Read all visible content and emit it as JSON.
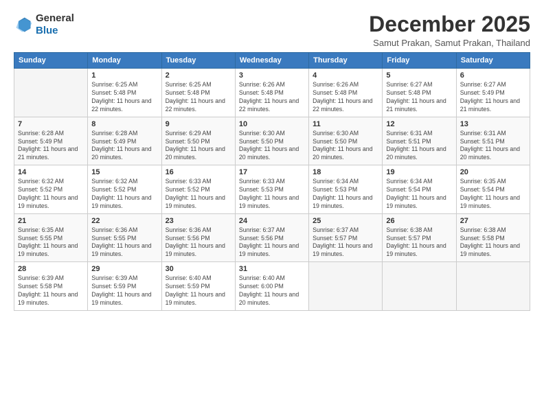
{
  "logo": {
    "line1": "General",
    "line2": "Blue"
  },
  "header": {
    "month": "December 2025",
    "location": "Samut Prakan, Samut Prakan, Thailand"
  },
  "weekdays": [
    "Sunday",
    "Monday",
    "Tuesday",
    "Wednesday",
    "Thursday",
    "Friday",
    "Saturday"
  ],
  "weeks": [
    [
      {
        "day": "",
        "info": ""
      },
      {
        "day": "1",
        "info": "Sunrise: 6:25 AM\nSunset: 5:48 PM\nDaylight: 11 hours and 22 minutes."
      },
      {
        "day": "2",
        "info": "Sunrise: 6:25 AM\nSunset: 5:48 PM\nDaylight: 11 hours and 22 minutes."
      },
      {
        "day": "3",
        "info": "Sunrise: 6:26 AM\nSunset: 5:48 PM\nDaylight: 11 hours and 22 minutes."
      },
      {
        "day": "4",
        "info": "Sunrise: 6:26 AM\nSunset: 5:48 PM\nDaylight: 11 hours and 22 minutes."
      },
      {
        "day": "5",
        "info": "Sunrise: 6:27 AM\nSunset: 5:48 PM\nDaylight: 11 hours and 21 minutes."
      },
      {
        "day": "6",
        "info": "Sunrise: 6:27 AM\nSunset: 5:49 PM\nDaylight: 11 hours and 21 minutes."
      }
    ],
    [
      {
        "day": "7",
        "info": "Sunrise: 6:28 AM\nSunset: 5:49 PM\nDaylight: 11 hours and 21 minutes."
      },
      {
        "day": "8",
        "info": "Sunrise: 6:28 AM\nSunset: 5:49 PM\nDaylight: 11 hours and 20 minutes."
      },
      {
        "day": "9",
        "info": "Sunrise: 6:29 AM\nSunset: 5:50 PM\nDaylight: 11 hours and 20 minutes."
      },
      {
        "day": "10",
        "info": "Sunrise: 6:30 AM\nSunset: 5:50 PM\nDaylight: 11 hours and 20 minutes."
      },
      {
        "day": "11",
        "info": "Sunrise: 6:30 AM\nSunset: 5:50 PM\nDaylight: 11 hours and 20 minutes."
      },
      {
        "day": "12",
        "info": "Sunrise: 6:31 AM\nSunset: 5:51 PM\nDaylight: 11 hours and 20 minutes."
      },
      {
        "day": "13",
        "info": "Sunrise: 6:31 AM\nSunset: 5:51 PM\nDaylight: 11 hours and 20 minutes."
      }
    ],
    [
      {
        "day": "14",
        "info": "Sunrise: 6:32 AM\nSunset: 5:52 PM\nDaylight: 11 hours and 19 minutes."
      },
      {
        "day": "15",
        "info": "Sunrise: 6:32 AM\nSunset: 5:52 PM\nDaylight: 11 hours and 19 minutes."
      },
      {
        "day": "16",
        "info": "Sunrise: 6:33 AM\nSunset: 5:52 PM\nDaylight: 11 hours and 19 minutes."
      },
      {
        "day": "17",
        "info": "Sunrise: 6:33 AM\nSunset: 5:53 PM\nDaylight: 11 hours and 19 minutes."
      },
      {
        "day": "18",
        "info": "Sunrise: 6:34 AM\nSunset: 5:53 PM\nDaylight: 11 hours and 19 minutes."
      },
      {
        "day": "19",
        "info": "Sunrise: 6:34 AM\nSunset: 5:54 PM\nDaylight: 11 hours and 19 minutes."
      },
      {
        "day": "20",
        "info": "Sunrise: 6:35 AM\nSunset: 5:54 PM\nDaylight: 11 hours and 19 minutes."
      }
    ],
    [
      {
        "day": "21",
        "info": "Sunrise: 6:35 AM\nSunset: 5:55 PM\nDaylight: 11 hours and 19 minutes."
      },
      {
        "day": "22",
        "info": "Sunrise: 6:36 AM\nSunset: 5:55 PM\nDaylight: 11 hours and 19 minutes."
      },
      {
        "day": "23",
        "info": "Sunrise: 6:36 AM\nSunset: 5:56 PM\nDaylight: 11 hours and 19 minutes."
      },
      {
        "day": "24",
        "info": "Sunrise: 6:37 AM\nSunset: 5:56 PM\nDaylight: 11 hours and 19 minutes."
      },
      {
        "day": "25",
        "info": "Sunrise: 6:37 AM\nSunset: 5:57 PM\nDaylight: 11 hours and 19 minutes."
      },
      {
        "day": "26",
        "info": "Sunrise: 6:38 AM\nSunset: 5:57 PM\nDaylight: 11 hours and 19 minutes."
      },
      {
        "day": "27",
        "info": "Sunrise: 6:38 AM\nSunset: 5:58 PM\nDaylight: 11 hours and 19 minutes."
      }
    ],
    [
      {
        "day": "28",
        "info": "Sunrise: 6:39 AM\nSunset: 5:58 PM\nDaylight: 11 hours and 19 minutes."
      },
      {
        "day": "29",
        "info": "Sunrise: 6:39 AM\nSunset: 5:59 PM\nDaylight: 11 hours and 19 minutes."
      },
      {
        "day": "30",
        "info": "Sunrise: 6:40 AM\nSunset: 5:59 PM\nDaylight: 11 hours and 19 minutes."
      },
      {
        "day": "31",
        "info": "Sunrise: 6:40 AM\nSunset: 6:00 PM\nDaylight: 11 hours and 20 minutes."
      },
      {
        "day": "",
        "info": ""
      },
      {
        "day": "",
        "info": ""
      },
      {
        "day": "",
        "info": ""
      }
    ]
  ]
}
